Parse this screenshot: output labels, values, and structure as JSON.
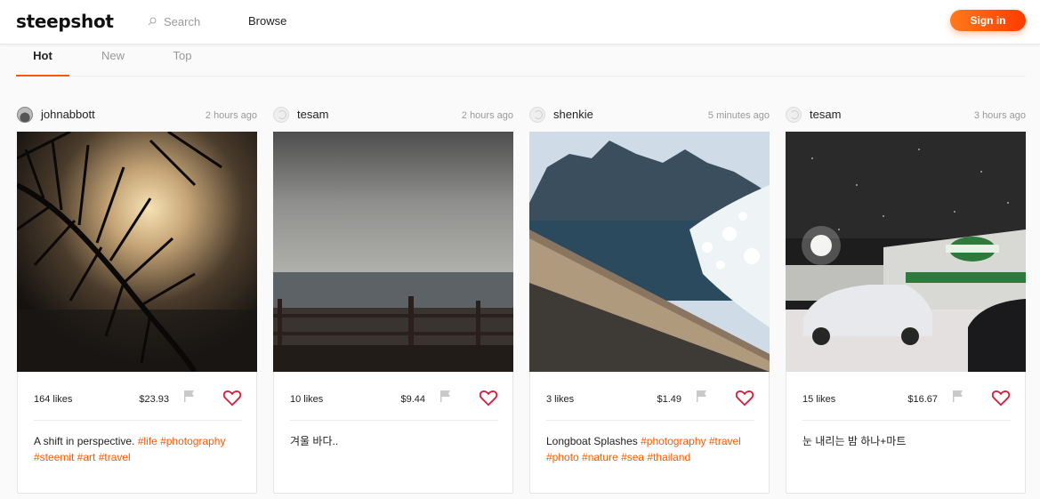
{
  "header": {
    "logo": "steepshot",
    "search_placeholder": "Search",
    "browse_label": "Browse",
    "signin_label": "Sign in",
    "accent_color": "#ff5a00"
  },
  "tabs": [
    {
      "label": "Hot",
      "active": true
    },
    {
      "label": "New",
      "active": false
    },
    {
      "label": "Top",
      "active": false
    }
  ],
  "posts": [
    {
      "author": "johnabbott",
      "time": "2 hours ago",
      "likes": "164 likes",
      "payout": "$23.93",
      "text": "A shift in perspective. ",
      "tags": "#life #photography #steemit #art #travel",
      "image": "sunset behind pine branches"
    },
    {
      "author": "tesam",
      "time": "2 hours ago",
      "likes": "10 likes",
      "payout": "$9.44",
      "text": "겨울 바다..",
      "tags": "",
      "image": "grey sea with wooden fence"
    },
    {
      "author": "shenkie",
      "time": "5 minutes ago",
      "likes": "3 likes",
      "payout": "$1.49",
      "text": "Longboat Splashes ",
      "tags": "#photography #travel #photo #nature #sea #thailand",
      "image": "boat bow splashing sea near cliffs"
    },
    {
      "author": "tesam",
      "time": "3 hours ago",
      "likes": "15 likes",
      "payout": "$16.67",
      "text": "눈 내리는 밤 하나+마트",
      "tags": "",
      "image": "snowy night parking lot with cars"
    }
  ]
}
